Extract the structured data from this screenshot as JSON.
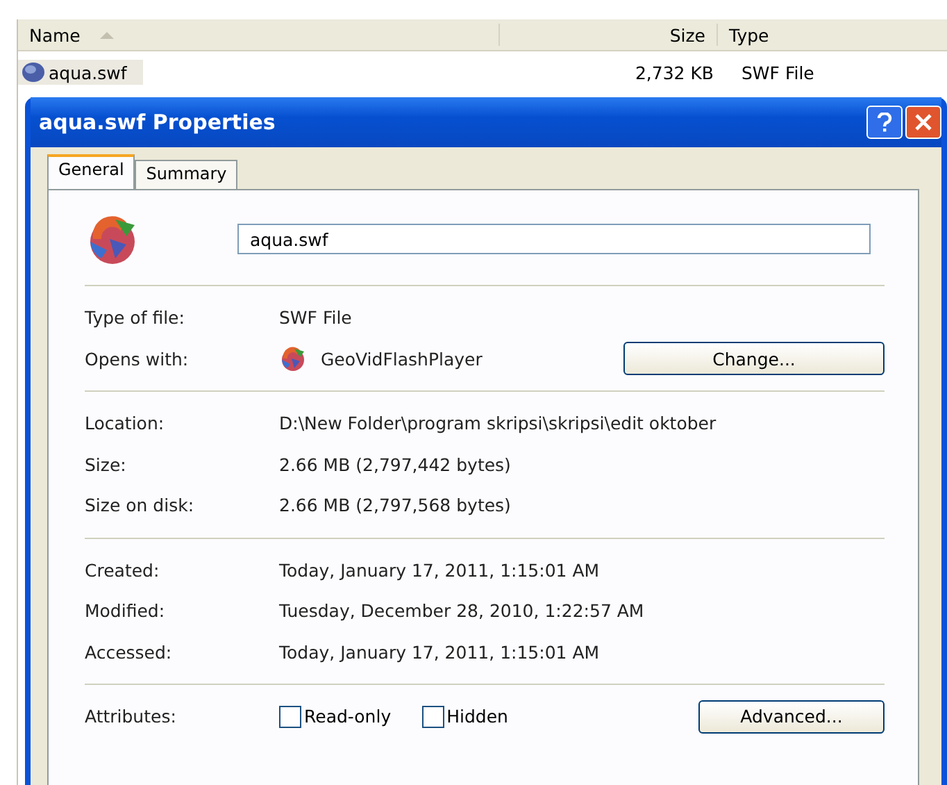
{
  "explorer": {
    "columns": [
      {
        "label": "Name",
        "sorted": true
      },
      {
        "label": "Size",
        "sorted": false
      },
      {
        "label": "Type",
        "sorted": false
      }
    ],
    "rows": [
      {
        "name": "aqua.swf",
        "size": "2,732 KB",
        "type": "SWF File",
        "selected": true
      }
    ]
  },
  "dialog": {
    "title": "aqua.swf Properties",
    "tabs": [
      {
        "label": "General",
        "selected": true
      },
      {
        "label": "Summary",
        "selected": false
      }
    ],
    "filename": "aqua.swf",
    "groups": [
      [
        {
          "kind": "text",
          "label": "Type of file:",
          "value": "SWF File"
        },
        {
          "kind": "app",
          "label": "Opens with:",
          "value": "GeoVidFlashPlayer",
          "button": "Change..."
        }
      ],
      [
        {
          "kind": "text",
          "label": "Location:",
          "value": "D:\\New Folder\\program skripsi\\skripsi\\edit oktober"
        },
        {
          "kind": "text",
          "label": "Size:",
          "value": "2.66 MB (2,797,442 bytes)"
        },
        {
          "kind": "text",
          "label": "Size on disk:",
          "value": "2.66 MB (2,797,568 bytes)"
        }
      ],
      [
        {
          "kind": "text",
          "label": "Created:",
          "value": "Today, January 17, 2011, 1:15:01 AM"
        },
        {
          "kind": "text",
          "label": "Modified:",
          "value": "Tuesday, December 28, 2010, 1:22:57 AM"
        },
        {
          "kind": "text",
          "label": "Accessed:",
          "value": "Today, January 17, 2011, 1:15:01 AM"
        }
      ],
      [
        {
          "kind": "attributes",
          "label": "Attributes:",
          "checkboxes": [
            {
              "label": "Read-only",
              "checked": false
            },
            {
              "label": "Hidden",
              "checked": false
            }
          ],
          "button": "Advanced..."
        }
      ]
    ]
  }
}
